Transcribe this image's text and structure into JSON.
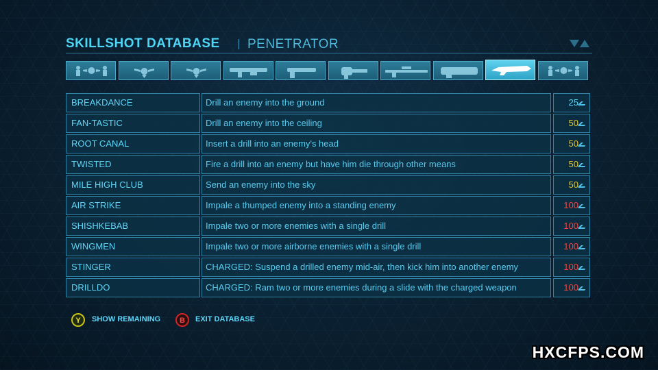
{
  "header": {
    "title": "SKILLSHOT DATABASE",
    "subtitle": "PENETRATOR"
  },
  "tabs": [
    {
      "icon": "soldiers-icon",
      "active": false
    },
    {
      "icon": "eagle-emblem-icon",
      "active": false
    },
    {
      "icon": "eagle-emblem-icon",
      "active": false
    },
    {
      "icon": "rifle-icon",
      "active": false
    },
    {
      "icon": "pistol-icon",
      "active": false
    },
    {
      "icon": "flail-gun-icon",
      "active": false
    },
    {
      "icon": "sniper-rifle-icon",
      "active": false
    },
    {
      "icon": "bouncer-icon",
      "active": false
    },
    {
      "icon": "penetrator-icon",
      "active": true
    },
    {
      "icon": "soldiers-icon",
      "active": false
    }
  ],
  "skillshots": [
    {
      "name": "BREAKDANCE",
      "description": "Drill an enemy into the ground",
      "points": "25",
      "tier": "low"
    },
    {
      "name": "FAN-TASTIC",
      "description": "Drill an enemy into the ceiling",
      "points": "50",
      "tier": "mid"
    },
    {
      "name": "ROOT CANAL",
      "description": "Insert a drill into an enemy's head",
      "points": "50",
      "tier": "mid"
    },
    {
      "name": "TWISTED",
      "description": "Fire a drill into an enemy but have him die through other means",
      "points": "50",
      "tier": "mid"
    },
    {
      "name": "MILE HIGH CLUB",
      "description": "Send an enemy into the sky",
      "points": "50",
      "tier": "mid"
    },
    {
      "name": "AIR STRIKE",
      "description": "Impale a thumped enemy into a standing enemy",
      "points": "100",
      "tier": "high"
    },
    {
      "name": "SHISHKEBAB",
      "description": "Impale two or more enemies with a single drill",
      "points": "100",
      "tier": "high"
    },
    {
      "name": "WINGMEN",
      "description": "Impale two or more airborne enemies with a single drill",
      "points": "100",
      "tier": "high"
    },
    {
      "name": "STINGER",
      "description": "CHARGED: Suspend a drilled enemy mid-air, then kick him into another enemy",
      "points": "100",
      "tier": "high"
    },
    {
      "name": "DRILLDO",
      "description": "CHARGED: Ram two or more enemies during a slide with the charged weapon",
      "points": "100",
      "tier": "high"
    }
  ],
  "tier_colors": {
    "low": "#5fd6f7",
    "mid": "#e3c52a",
    "high": "#f2453f"
  },
  "footer": {
    "y_button": "Y",
    "show_remaining": "SHOW REMAINING",
    "b_button": "B",
    "exit_database": "EXIT DATABASE"
  },
  "watermark": "HXCFPS.COM"
}
